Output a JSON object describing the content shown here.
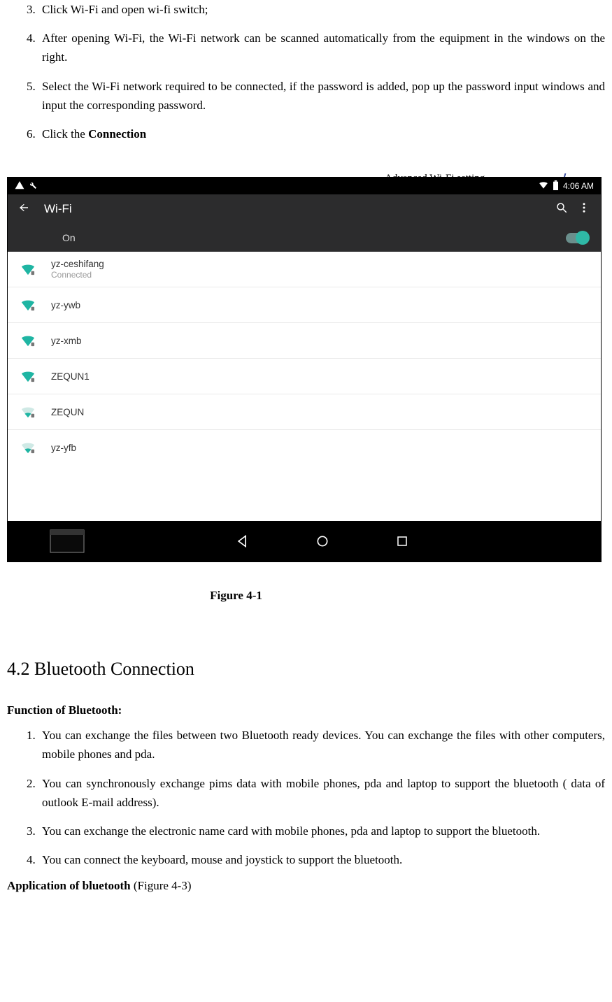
{
  "steps_top": {
    "start": 3,
    "items": [
      "Click Wi-Fi and open wi-fi switch;",
      "After opening Wi-Fi, the Wi-Fi network can be scanned automatically from the equipment in the windows on the right.",
      "Select the Wi-Fi network required to be connected, if the password is added, pop up the password input windows and input the corresponding password.",
      "Click the Connection"
    ],
    "bold_in_last": "Connection"
  },
  "annotation": "Advanced Wi-Fi setting",
  "screenshot": {
    "status_time": "4:06 AM",
    "appbar_title": "Wi-Fi",
    "toggle_label": "On",
    "toggle_state": true,
    "networks": [
      {
        "name": "yz-ceshifang",
        "sub": "Connected",
        "strength": "strong",
        "secure": true
      },
      {
        "name": "yz-ywb",
        "sub": "",
        "strength": "strong",
        "secure": true
      },
      {
        "name": "yz-xmb",
        "sub": "",
        "strength": "strong",
        "secure": true
      },
      {
        "name": "ZEQUN1",
        "sub": "",
        "strength": "strong",
        "secure": true
      },
      {
        "name": "ZEQUN",
        "sub": "",
        "strength": "weak",
        "secure": true
      },
      {
        "name": "yz-yfb",
        "sub": "",
        "strength": "weak",
        "secure": true
      }
    ]
  },
  "figure_caption": "Figure   4-1",
  "subsection_heading": "4.2 Bluetooth Connection",
  "bt_function_heading": "Function of Bluetooth:",
  "bt_items": [
    "You can exchange the files between two Bluetooth ready devices. You can exchange the files with other computers, mobile phones and pda.",
    "You can synchronously exchange pims data with mobile phones, pda and laptop to support the bluetooth ( data of outlook E-mail address).",
    "You can exchange the electronic name card with mobile phones, pda and laptop to support the bluetooth.",
    "You can connect the keyboard, mouse and joystick to support the bluetooth."
  ],
  "bt_app_heading_bold": "Application of bluetooth",
  "bt_app_heading_rest": " (Figure 4-3)"
}
